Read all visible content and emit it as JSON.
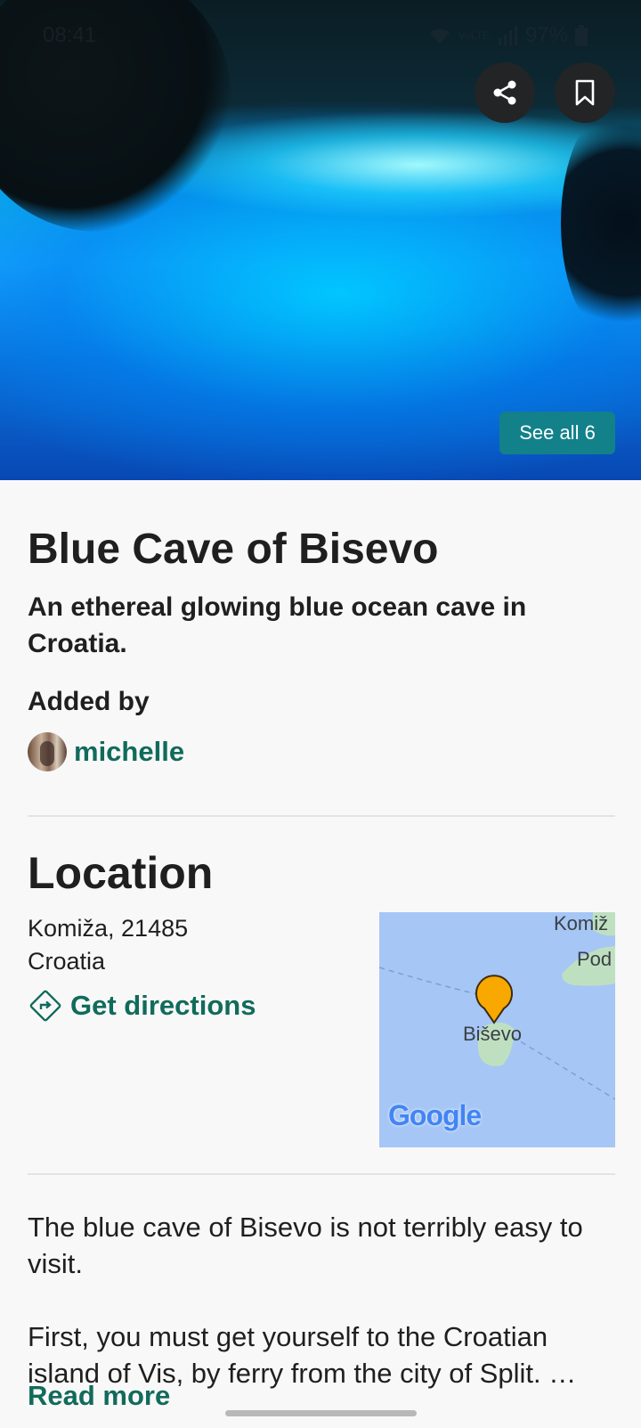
{
  "status_bar": {
    "time": "08:41",
    "battery": "97%",
    "network": "VoLTE"
  },
  "hero": {
    "see_all_label": "See all 6"
  },
  "place": {
    "title": "Blue Cave of Bisevo",
    "subtitle": "An ethereal glowing blue ocean cave in Croatia.",
    "added_by_label": "Added by",
    "author": "michelle"
  },
  "location": {
    "heading": "Location",
    "address_line1": "Komiža, 21485",
    "address_line2": "Croatia",
    "directions_label": "Get directions",
    "map": {
      "pin_label": "Biševo",
      "label_top": "Komiž",
      "label_right": "Pod",
      "provider": "Google"
    }
  },
  "description": {
    "para1": "The blue cave of Bisevo is not terribly easy to visit.",
    "para2": "First, you must get yourself to the Croatian island of Vis, by ferry from the city of Split. …",
    "read_more": "Read more"
  },
  "colors": {
    "accent": "#116b5b",
    "see_all_bg": "#12818a",
    "pin": "#f9a800"
  }
}
